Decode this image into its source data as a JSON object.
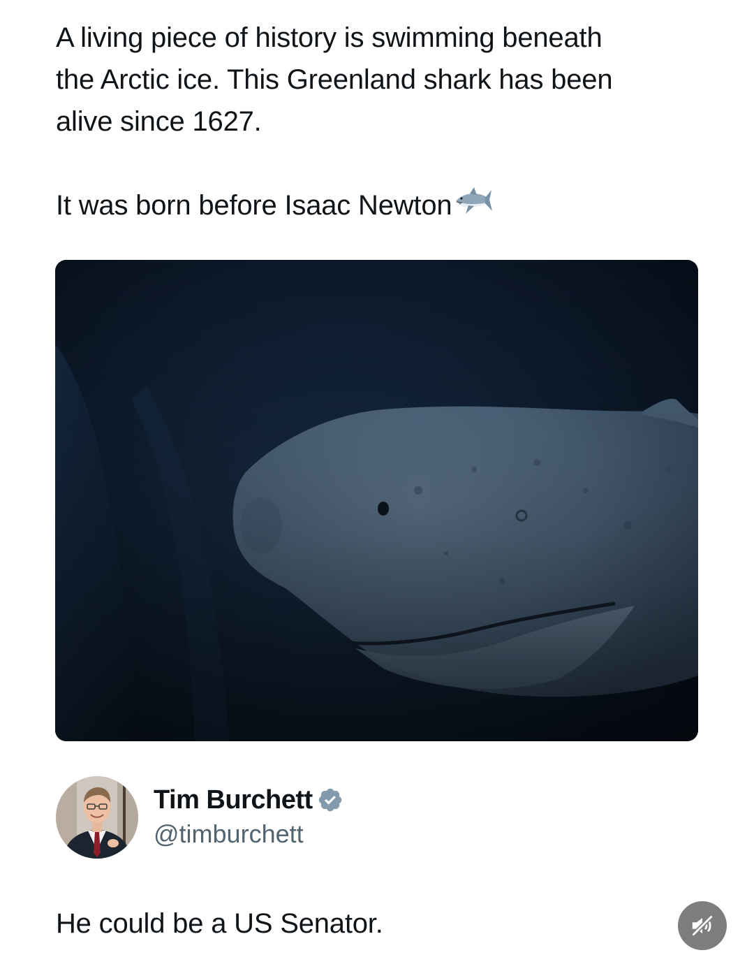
{
  "post": {
    "line_1": "A living piece of history is swimming beneath",
    "line_2": "the Arctic ice. This Greenland shark has been",
    "line_3": "alive since 1627.",
    "line_4": "It was born before Isaac Newton",
    "emoji": "shark-emoji"
  },
  "media": {
    "subject": "greenland-shark-photo"
  },
  "author": {
    "name": "Tim Burchett",
    "handle": "@timburchett",
    "verified": true,
    "verified_color": "#1d9bf0"
  },
  "reply": {
    "text": "He could be a US Senator."
  },
  "controls": {
    "mute_icon": "speaker-muted-icon"
  }
}
